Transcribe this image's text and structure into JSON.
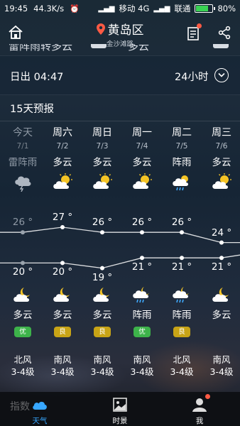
{
  "status_bar": {
    "time": "19:45",
    "speed": "44.3K/s",
    "carrier1": "移动 4G",
    "carrier2": "联通",
    "battery": "80%",
    "battery_level": 0.8
  },
  "header": {
    "city": "黄岛区",
    "subtitle": "金沙滩路"
  },
  "clipped_row": {
    "left_text": "雷阵雨转多云",
    "right_text": "多云"
  },
  "sunrise": {
    "label": "日出 04:47",
    "hours_label": "24小时"
  },
  "forecast": {
    "title": "15天预报",
    "days": [
      {
        "day": "今天",
        "date": "7/1",
        "day_cond": "雷阵雨",
        "day_icon": "thunderstorm-icon",
        "high": 26,
        "high_label": "26 °",
        "low": 20,
        "low_label": "20 °",
        "night_cond": "多云",
        "night_icon": "partly-cloudy-night-icon",
        "aqi": "优",
        "aqi_color": "#3db34a",
        "wind_dir": "北风",
        "wind_level": "3-4级",
        "past": true
      },
      {
        "day": "周六",
        "date": "7/2",
        "day_cond": "多云",
        "day_icon": "partly-cloudy-icon",
        "high": 27,
        "high_label": "27 °",
        "low": 20,
        "low_label": "20 °",
        "night_cond": "多云",
        "night_icon": "partly-cloudy-night-icon",
        "aqi": "良",
        "aqi_color": "#c8a416",
        "wind_dir": "南风",
        "wind_level": "3-4级",
        "past": false
      },
      {
        "day": "周日",
        "date": "7/3",
        "day_cond": "多云",
        "day_icon": "partly-cloudy-icon",
        "high": 26,
        "high_label": "26 °",
        "low": 19,
        "low_label": "19 °",
        "night_cond": "多云",
        "night_icon": "partly-cloudy-night-icon",
        "aqi": "良",
        "aqi_color": "#c8a416",
        "wind_dir": "南风",
        "wind_level": "3-4级",
        "past": false
      },
      {
        "day": "周一",
        "date": "7/4",
        "day_cond": "多云",
        "day_icon": "partly-cloudy-icon",
        "high": 26,
        "high_label": "26 °",
        "low": 21,
        "low_label": "21 °",
        "night_cond": "阵雨",
        "night_icon": "shower-night-icon",
        "aqi": "优",
        "aqi_color": "#3db34a",
        "wind_dir": "南风",
        "wind_level": "3-4级",
        "past": false
      },
      {
        "day": "周二",
        "date": "7/5",
        "day_cond": "阵雨",
        "day_icon": "shower-icon",
        "high": 26,
        "high_label": "26 °",
        "low": 21,
        "low_label": "21 °",
        "night_cond": "阵雨",
        "night_icon": "shower-night-icon",
        "aqi": "良",
        "aqi_color": "#c8a416",
        "wind_dir": "北风",
        "wind_level": "3-4级",
        "past": false
      },
      {
        "day": "周三",
        "date": "7/6",
        "day_cond": "多云",
        "day_icon": "partly-cloudy-icon",
        "high": 24,
        "high_label": "24 °",
        "low": 21,
        "low_label": "21 °",
        "night_cond": "多云",
        "night_icon": "partly-cloudy-night-icon",
        "aqi": "",
        "aqi_color": "",
        "wind_dir": "南风",
        "wind_level": "3-4级",
        "past": false
      }
    ]
  },
  "bottom_nav": {
    "faded_label": "指数",
    "tabs": [
      {
        "label": "天气",
        "icon": "cloud-icon",
        "active": true
      },
      {
        "label": "时景",
        "icon": "photo-icon",
        "active": false
      },
      {
        "label": "我",
        "icon": "user-icon",
        "active": false
      }
    ]
  }
}
